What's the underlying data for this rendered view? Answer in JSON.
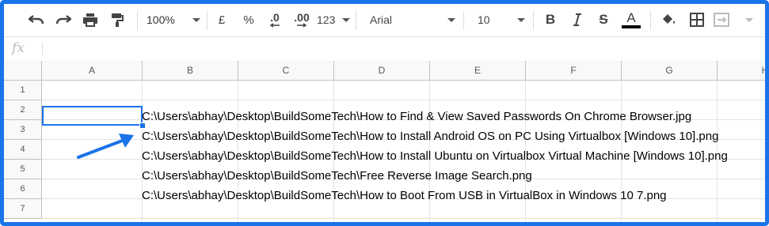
{
  "toolbar": {
    "zoom_value": "100%",
    "currency_label": "£",
    "percent_label": "%",
    "decrease_decimals_label": ".0",
    "increase_decimals_label": ".00",
    "more_formats_label": "123",
    "font_family_value": "Arial",
    "font_size_value": "10",
    "bold_label": "B",
    "strike_label": "S",
    "text_color_label": "A",
    "text_color": "#000000"
  },
  "formula_bar": {
    "fx_label": "fx",
    "value": ""
  },
  "columns": [
    "A",
    "B",
    "C",
    "D",
    "E",
    "F",
    "G",
    "H"
  ],
  "rows": [
    "1",
    "2",
    "3",
    "4",
    "5",
    "6",
    "7"
  ],
  "cells": {
    "b2": "C:\\Users\\abhay\\Desktop\\BuildSomeTech\\How to Find & View Saved Passwords On Chrome Browser.jpg",
    "b3": "C:\\Users\\abhay\\Desktop\\BuildSomeTech\\How to Install Android OS on PC Using Virtualbox [Windows 10].png",
    "b4": "C:\\Users\\abhay\\Desktop\\BuildSomeTech\\How to Install Ubuntu on Virtualbox Virtual Machine [Windows 10].png",
    "b5": "C:\\Users\\abhay\\Desktop\\BuildSomeTech\\Free Reverse Image Search.png",
    "b6": "C:\\Users\\abhay\\Desktop\\BuildSomeTech\\How to Boot From USB in VirtualBox in Windows 10 7.png"
  },
  "selection": "A2",
  "accent_color": "#1a73e8"
}
